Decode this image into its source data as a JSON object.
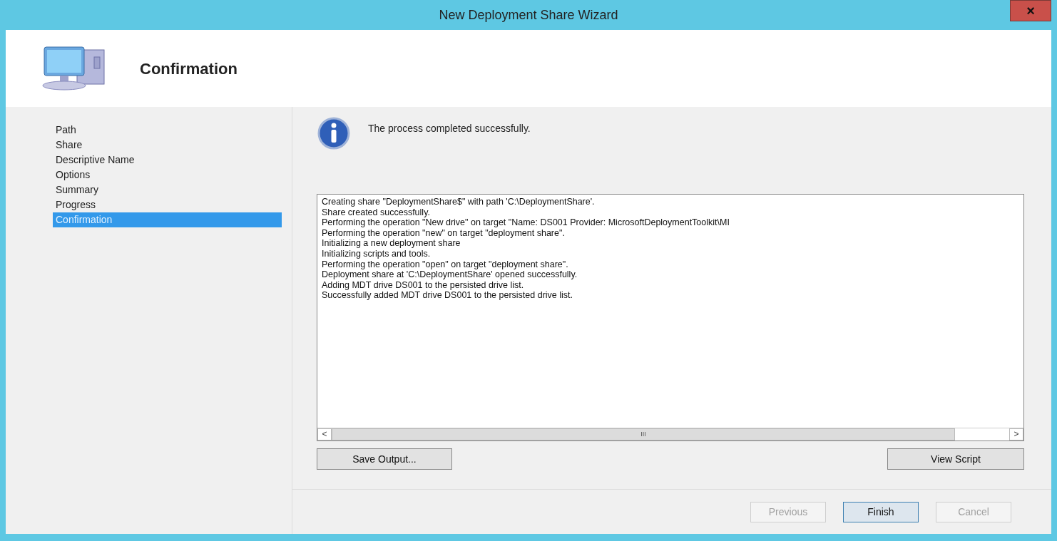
{
  "window": {
    "title": "New Deployment Share Wizard",
    "close": "×"
  },
  "header": {
    "title": "Confirmation"
  },
  "steps": [
    {
      "label": "Path",
      "selected": false
    },
    {
      "label": "Share",
      "selected": false
    },
    {
      "label": "Descriptive Name",
      "selected": false
    },
    {
      "label": "Options",
      "selected": false
    },
    {
      "label": "Summary",
      "selected": false
    },
    {
      "label": "Progress",
      "selected": false
    },
    {
      "label": "Confirmation",
      "selected": true
    }
  ],
  "message": "The process completed successfully.",
  "log": {
    "lines": [
      "Creating share \"DeploymentShare$\" with path 'C:\\DeploymentShare'.",
      "Share created successfully.",
      "Performing the operation \"New drive\" on target \"Name: DS001 Provider: MicrosoftDeploymentToolkit\\MI",
      "Performing the operation \"new\" on target \"deployment share\".",
      "Initializing a new deployment share",
      "Initializing scripts and tools.",
      "Performing the operation \"open\" on target \"deployment share\".",
      "Deployment share at 'C:\\DeploymentShare' opened successfully.",
      "Adding MDT drive DS001 to the persisted drive list.",
      "Successfully added MDT drive DS001 to the persisted drive list."
    ],
    "scroll_left": "<",
    "scroll_grip": "III",
    "scroll_right": ">"
  },
  "actions": [
    {
      "label": "Save Output..."
    },
    {
      "label": "View Script"
    }
  ],
  "buttons": [
    {
      "label": "Previous",
      "disabled": true,
      "default": false
    },
    {
      "label": "Finish",
      "disabled": false,
      "default": true
    },
    {
      "label": "Cancel",
      "disabled": true,
      "default": false
    }
  ]
}
